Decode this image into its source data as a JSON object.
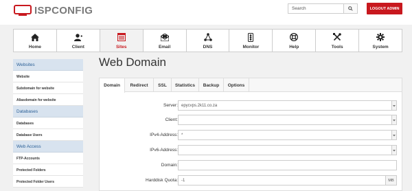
{
  "header": {
    "logo_text": "ISPCONFIG",
    "search_placeholder": "Search",
    "logout_label": "LOGOUT ADMIN",
    "accent_color": "#c8181e"
  },
  "nav": {
    "items": [
      {
        "label": "Home",
        "icon": "home-icon"
      },
      {
        "label": "Client",
        "icon": "user-icon"
      },
      {
        "label": "Sites",
        "icon": "sites-icon",
        "active": true
      },
      {
        "label": "Email",
        "icon": "email-icon"
      },
      {
        "label": "DNS",
        "icon": "dns-icon"
      },
      {
        "label": "Monitor",
        "icon": "monitor-icon"
      },
      {
        "label": "Help",
        "icon": "help-icon"
      },
      {
        "label": "Tools",
        "icon": "tools-icon"
      },
      {
        "label": "System",
        "icon": "gear-icon"
      }
    ]
  },
  "sidebar": {
    "sections": [
      {
        "title": "Websites",
        "items": [
          "Website",
          "Subdomain for website",
          "Aliasdomain for website"
        ]
      },
      {
        "title": "Databases",
        "items": [
          "Databases",
          "Database Users"
        ]
      },
      {
        "title": "Web Access",
        "items": [
          "FTP-Accounts",
          "Protected Folders",
          "Protected Folder Users"
        ]
      }
    ]
  },
  "main": {
    "title": "Web Domain",
    "tabs": [
      "Domain",
      "Redirect",
      "SSL",
      "Statistics",
      "Backup",
      "Options"
    ],
    "active_tab": "Domain",
    "form": {
      "server_label": "Server:",
      "server_value": "epycvps.2k11.co.za",
      "client_label": "Client:",
      "client_value": "",
      "ipv4_label": "IPv4-Address:",
      "ipv4_value": "*",
      "ipv6_label": "IPv6-Address:",
      "ipv6_value": "",
      "domain_label": "Domain:",
      "domain_value": "",
      "quota_label": "Harddisk Quota:",
      "quota_value": "-1",
      "quota_unit": "MB"
    }
  }
}
